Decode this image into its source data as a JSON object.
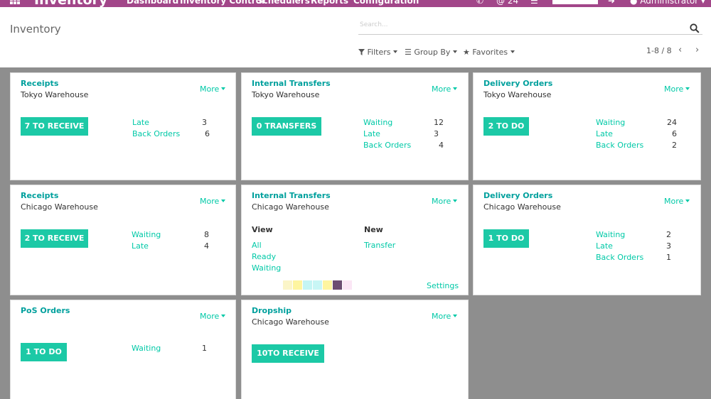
{
  "navbar": {
    "brand": "Inventory",
    "menu": [
      "Dashboard",
      "Inventory Control",
      "Schedulers",
      "Reports",
      "Configuration"
    ],
    "message_count": "24",
    "user": "Administrator",
    "color": "#a24689"
  },
  "control_panel": {
    "title": "Inventory",
    "search_placeholder": "Search...",
    "filters_label": "Filters",
    "group_by_label": "Group By",
    "favorites_label": "Favorites",
    "pager": "1-8 / 8"
  },
  "cards": [
    {
      "title": "Receipts",
      "subtitle": "Tokyo Warehouse",
      "more": "More",
      "action": "7 TO RECEIVE",
      "rows": [
        {
          "label": "Late",
          "count": "3"
        },
        {
          "label": "Back Orders",
          "count": "6"
        }
      ]
    },
    {
      "title": "Internal Transfers",
      "subtitle": "Tokyo Warehouse",
      "more": "More",
      "action": "0 TRANSFERS",
      "rows": [
        {
          "label": "Waiting",
          "count": "12"
        },
        {
          "label": "Late",
          "count": "3"
        },
        {
          "label": "Back Orders",
          "count": "4"
        }
      ]
    },
    {
      "title": "Delivery Orders",
      "subtitle": "Tokyo Warehouse",
      "more": "More",
      "action": "2 TO DO",
      "rows": [
        {
          "label": "Waiting",
          "count": "24"
        },
        {
          "label": "Late",
          "count": "6"
        },
        {
          "label": "Back Orders",
          "count": "2"
        }
      ]
    },
    {
      "title": "Receipts",
      "subtitle": "Chicago Warehouse",
      "more": "More",
      "action": "2 TO RECEIVE",
      "rows": [
        {
          "label": "Waiting",
          "count": "8"
        },
        {
          "label": "Late",
          "count": "4"
        }
      ]
    },
    {
      "title": "Internal Transfers",
      "subtitle": "Chicago Warehouse",
      "more": "More",
      "view_header": "View",
      "view_items": [
        "All",
        "Ready",
        "Waiting"
      ],
      "new_header": "New",
      "new_items": [
        "Transfer"
      ],
      "settings": "Settings",
      "swatches": [
        "#fbf5c8",
        "#fef5a0",
        "#c4f5f4",
        "#c8f6f5",
        "#fef5a0",
        "#6c4d71",
        "#fbe6f5"
      ]
    },
    {
      "title": "Delivery Orders",
      "subtitle": "Chicago Warehouse",
      "more": "More",
      "action": "1 TO DO",
      "rows": [
        {
          "label": "Waiting",
          "count": "2"
        },
        {
          "label": "Late",
          "count": "3"
        },
        {
          "label": "Back Orders",
          "count": "1"
        }
      ]
    },
    {
      "title": "PoS Orders",
      "subtitle": "",
      "more": "More",
      "action": "1 TO DO",
      "rows": [
        {
          "label": "Waiting",
          "count": "1"
        }
      ]
    },
    {
      "title": "Dropship",
      "subtitle": "Chicago Warehouse",
      "more": "More",
      "action": "10TO RECEIVE",
      "rows": []
    }
  ],
  "colors": {
    "accent": "#1cc9a6",
    "link": "#00c9a7",
    "title": "#00a09d",
    "background": "#8e8e8e"
  }
}
